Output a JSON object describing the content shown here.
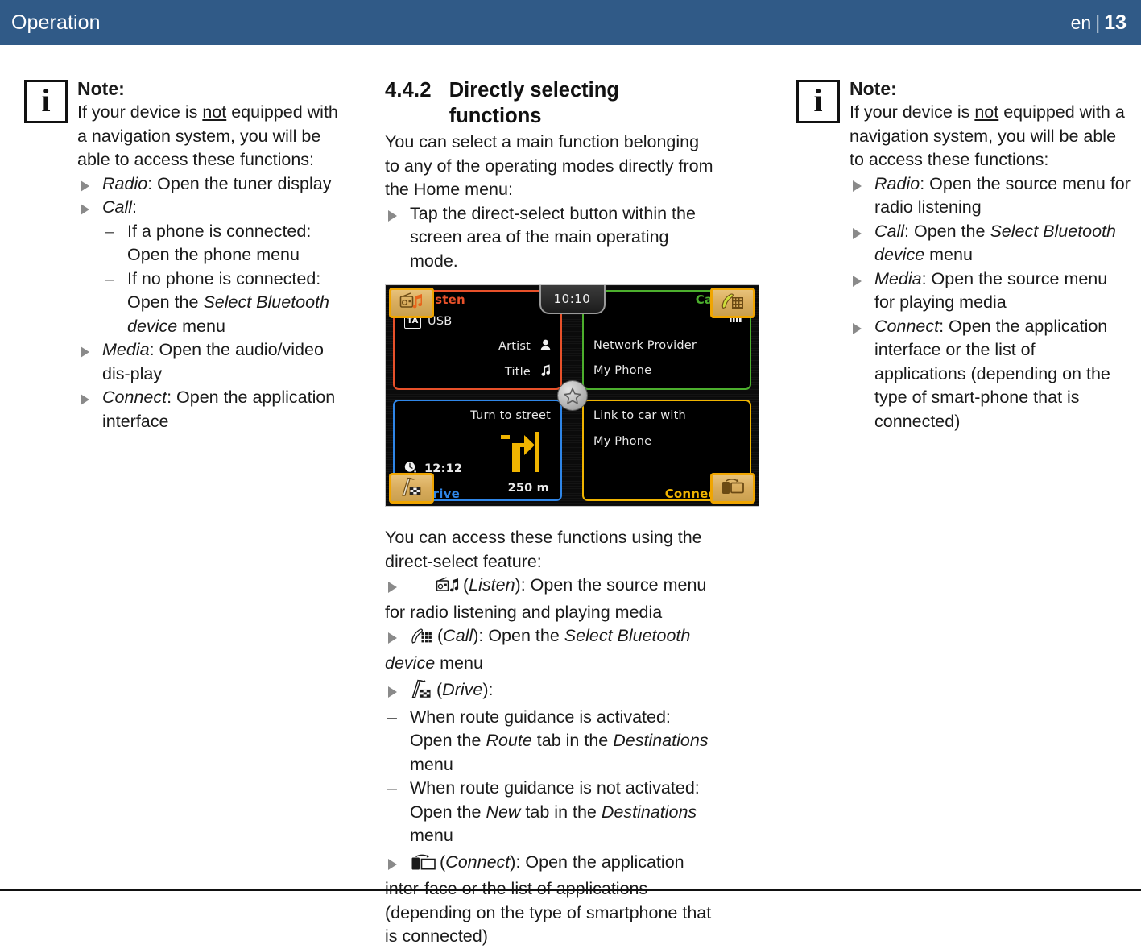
{
  "header": {
    "title": "Operation",
    "language": "en",
    "separator": "|",
    "page_number": "13",
    "bg_color": "#305a87"
  },
  "left_note": {
    "icon": "info-icon",
    "icon_glyph": "i",
    "title": "Note:",
    "intro_before_not": "If your device is ",
    "intro_not": "not",
    "intro_after_not": " equipped with a navigation system, you will be able to access these functions:",
    "items": [
      {
        "term": "Radio",
        "text": ": Open the tuner display"
      },
      {
        "term": "Call",
        "text": ":",
        "subitems": [
          {
            "text_1": "If a phone is connected: Open the phone menu"
          },
          {
            "text_1": "If no phone is connected: Open the ",
            "italic": "Select Bluetooth device",
            "text_2": " menu"
          }
        ]
      },
      {
        "term": "Media",
        "text": ": Open the audio/video dis‐play"
      },
      {
        "term": "Connect",
        "text": ": Open the application interface"
      }
    ]
  },
  "middle": {
    "heading_number": "4.4.2",
    "heading_title": "Directly selecting functions",
    "intro": "You can select a main function belonging to any of the operating modes directly from the Home menu:",
    "action_bullet": "Tap the direct-select button within the screen area of the main operating mode.",
    "after_image_intro": "You can access these functions using the direct-select feature:",
    "direct_items": [
      {
        "icon": "radio-music-icon",
        "paren_open": "(",
        "term": "Listen",
        "paren_close": ")",
        "text": ": Open the source menu for radio listening and playing media"
      },
      {
        "icon": "phone-keypad-icon",
        "paren_open": "(",
        "term": "Call",
        "paren_close": ")",
        "text_1": ": Open the ",
        "italic": "Select Bluetooth device",
        "text_2": " menu"
      },
      {
        "icon": "nav-flag-icon",
        "paren_open": "(",
        "term": "Drive",
        "paren_close": ")",
        "text": ":",
        "subitems": [
          {
            "text_1": "When route guidance is activated: Open the ",
            "italic_1": "Route",
            "text_2": " tab in the ",
            "italic_2": "Destinations",
            "text_3": " menu"
          },
          {
            "text_1": "When route guidance is not activated: Open the ",
            "italic_1": "New",
            "text_2": " tab in the ",
            "italic_2": "Destinations",
            "text_3": " menu"
          }
        ]
      },
      {
        "icon": "phone-screen-connect-icon",
        "paren_open": "(",
        "term": "Connect",
        "paren_close": ")",
        "text": ": Open the application inter‐face or the list of applications (depending on the type of smartphone that is connected)"
      }
    ]
  },
  "hmi_screen": {
    "clock": "10:10",
    "center_icon": "favorites-star-icon",
    "quadrants": [
      {
        "key": "listen",
        "label": "Listen",
        "color": "#e8512a",
        "badge": "TA",
        "source": "USB",
        "rows": [
          {
            "text": "Artist",
            "icon": "person-icon"
          },
          {
            "text": "Title",
            "icon": "music-note-icon"
          }
        ]
      },
      {
        "key": "call",
        "label": "Call",
        "color": "#4caf2d",
        "signal_icon": "signal-bars-icon",
        "rows": [
          {
            "text": "Network Provider"
          },
          {
            "text": "My Phone"
          }
        ]
      },
      {
        "key": "drive",
        "label": "Drive",
        "color": "#2f86e8",
        "rows": [
          {
            "text": "Turn to street"
          }
        ],
        "eta_icon": "clock-icon",
        "eta": "12:12",
        "maneuver_icon": "turn-right-arrow-icon",
        "distance": "250 m"
      },
      {
        "key": "connect",
        "label": "Connect",
        "color": "#f0b400",
        "rows": [
          {
            "text": "Link to car with"
          },
          {
            "text": "My Phone"
          }
        ]
      }
    ],
    "direct_select_buttons": [
      {
        "position": "top-left",
        "icon": "radio-music-icon",
        "target": "Listen"
      },
      {
        "position": "top-right",
        "icon": "phone-keypad-icon",
        "target": "Call"
      },
      {
        "position": "bottom-left",
        "icon": "nav-flag-icon",
        "target": "Drive"
      },
      {
        "position": "bottom-right",
        "icon": "phone-screen-connect-icon",
        "target": "Connect"
      }
    ]
  },
  "right_note": {
    "icon": "info-icon",
    "icon_glyph": "i",
    "title": "Note:",
    "intro_before_not": "If your device is ",
    "intro_not": "not",
    "intro_after_not": " equipped with a navigation system, you will be able to access these functions:",
    "items": [
      {
        "term": "Radio",
        "text": ": Open the source menu for radio listening"
      },
      {
        "term": "Call",
        "text_1": ": Open the ",
        "italic": "Select Bluetooth device",
        "text_2": " menu"
      },
      {
        "term": "Media",
        "text": ": Open the source menu for playing media"
      },
      {
        "term": "Connect",
        "text": ": Open the application interface or the list of applications (depending on the type of smart‐phone that is connected)"
      }
    ]
  }
}
